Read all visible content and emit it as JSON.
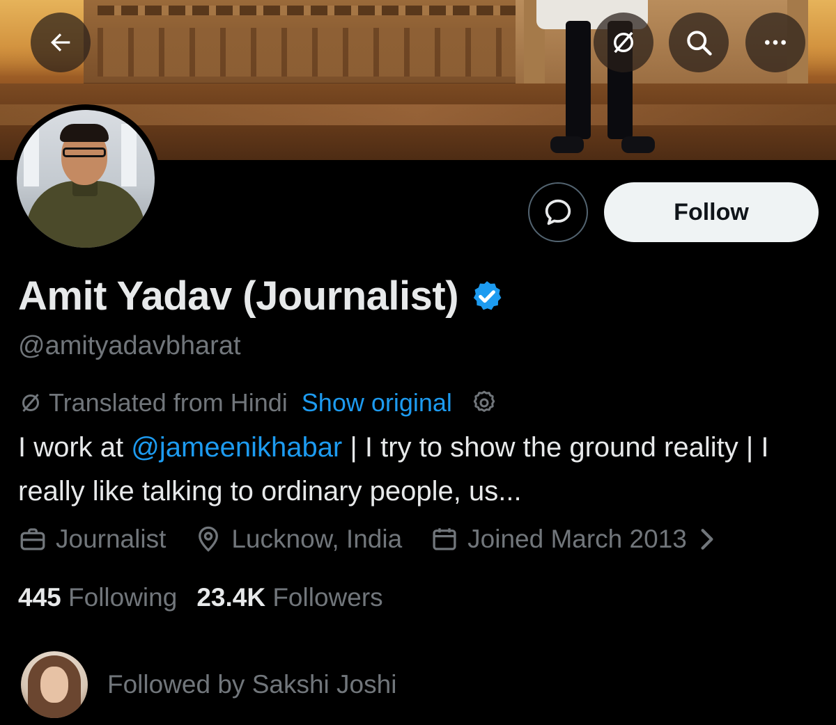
{
  "profile": {
    "name": "Amit Yadav (Journalist)",
    "handle": "@amityadavbharat",
    "follow_label": "Follow",
    "verified_color": "#1d9bf0"
  },
  "translation": {
    "notice": "Translated from Hindi",
    "show_original": "Show original"
  },
  "bio": {
    "part1": "I work at ",
    "mention": "@jameenikhabar",
    "part2": " | I try to show the ground reality | I really like talking to ordinary people, us..."
  },
  "meta": {
    "profession": "Journalist",
    "location": "Lucknow, India",
    "joined": "Joined March 2013"
  },
  "stats": {
    "following_count": "445",
    "following_label": "Following",
    "followers_count": "23.4K",
    "followers_label": "Followers"
  },
  "followed_by": {
    "text": "Followed by Sakshi Joshi"
  },
  "icons": {
    "back": "arrow-left-icon",
    "translate": "translate-slash-icon",
    "search": "search-icon",
    "more": "more-icon",
    "message": "message-icon",
    "verified": "verified-badge-icon",
    "settings": "gear-icon",
    "profession": "briefcase-icon",
    "location": "location-pin-icon",
    "joined": "calendar-icon"
  },
  "colors": {
    "background": "#000000",
    "text": "#e7e9ea",
    "muted": "#71767b",
    "link": "#1d9bf0",
    "follow_button_bg": "#eff3f4"
  }
}
